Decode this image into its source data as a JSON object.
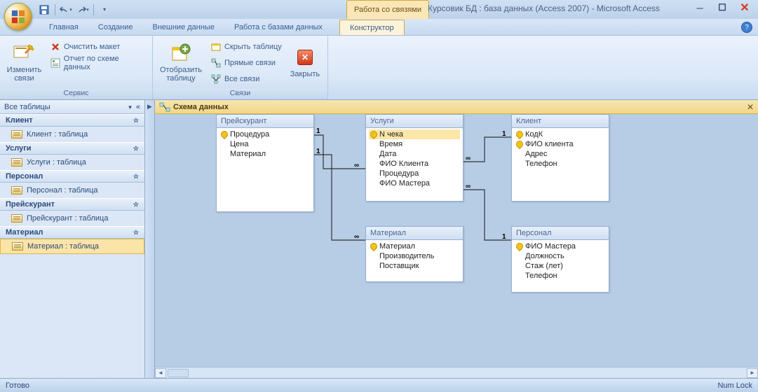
{
  "title": "Курсовик БД : база данных (Access 2007)  -  Microsoft Access",
  "context_title": "Работа со связями",
  "tabs": [
    "Главная",
    "Создание",
    "Внешние данные",
    "Работа с базами данных"
  ],
  "context_tab": "Конструктор",
  "ribbon": {
    "group1_title": "Сервис",
    "edit_rel": "Изменить\nсвязи",
    "clear_layout": "Очистить макет",
    "rel_report": "Отчет по схеме данных",
    "group2_title": "Связи",
    "show_table": "Отобразить\nтаблицу",
    "hide_table": "Скрыть таблицу",
    "direct_rel": "Прямые связи",
    "all_rel": "Все связи",
    "close": "Закрыть"
  },
  "nav": {
    "header": "Все таблицы",
    "groups": [
      {
        "name": "Клиент",
        "items": [
          "Клиент : таблица"
        ]
      },
      {
        "name": "Услуги",
        "items": [
          "Услуги : таблица"
        ]
      },
      {
        "name": "Персонал",
        "items": [
          "Персонал : таблица"
        ]
      },
      {
        "name": "Прейскурант",
        "items": [
          "Прейскурант : таблица"
        ]
      },
      {
        "name": "Материал",
        "items": [
          "Материал : таблица"
        ]
      }
    ]
  },
  "doc_tab": "Схема данных",
  "tables": {
    "preis": {
      "title": "Прейскурант",
      "fields": [
        {
          "k": 1,
          "n": "Процедура"
        },
        {
          "k": 0,
          "n": "Цена"
        },
        {
          "k": 0,
          "n": "Материал"
        }
      ]
    },
    "uslugi": {
      "title": "Услуги",
      "fields": [
        {
          "k": 1,
          "n": "N чека",
          "sel": 1
        },
        {
          "k": 0,
          "n": "Время"
        },
        {
          "k": 0,
          "n": "Дата"
        },
        {
          "k": 0,
          "n": "ФИО Клиента"
        },
        {
          "k": 0,
          "n": "Процедура"
        },
        {
          "k": 0,
          "n": "ФИО Мастера"
        }
      ]
    },
    "klient": {
      "title": "Клиент",
      "fields": [
        {
          "k": 1,
          "n": "КодК"
        },
        {
          "k": 1,
          "n": "ФИО клиента"
        },
        {
          "k": 0,
          "n": "Адрес"
        },
        {
          "k": 0,
          "n": "Телефон"
        }
      ]
    },
    "material": {
      "title": "Материал",
      "fields": [
        {
          "k": 1,
          "n": "Материал"
        },
        {
          "k": 0,
          "n": "Производитель"
        },
        {
          "k": 0,
          "n": "Поставщик"
        }
      ]
    },
    "personal": {
      "title": "Персонал",
      "fields": [
        {
          "k": 1,
          "n": "ФИО Мастера"
        },
        {
          "k": 0,
          "n": "Должность"
        },
        {
          "k": 0,
          "n": "Стаж (лет)"
        },
        {
          "k": 0,
          "n": "Телефон"
        }
      ]
    }
  },
  "status_left": "Готово",
  "status_right": "Num Lock"
}
